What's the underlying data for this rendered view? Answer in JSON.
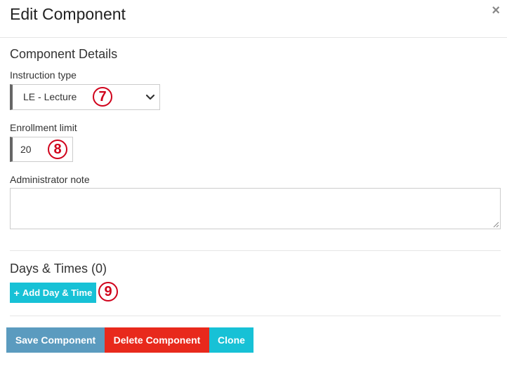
{
  "modal": {
    "title": "Edit Component",
    "close_label": "×"
  },
  "details": {
    "section_title": "Component Details",
    "instruction_type": {
      "label": "Instruction type",
      "value": "LE - Lecture"
    },
    "enrollment_limit": {
      "label": "Enrollment limit",
      "value": "20"
    },
    "administrator_note": {
      "label": "Administrator note",
      "value": ""
    }
  },
  "days_times": {
    "section_title": "Days & Times (0)",
    "add_label": "Add Day & Time"
  },
  "annotations": {
    "callout_7": "7",
    "callout_8": "8",
    "callout_9": "9"
  },
  "footer": {
    "save_label": "Save Component",
    "delete_label": "Delete Component",
    "clone_label": "Clone"
  },
  "colors": {
    "save": "#5b9bbf",
    "delete": "#e8291c",
    "accent": "#17c1d6",
    "callout": "#d0021b"
  },
  "icons": {
    "close": "close-icon",
    "select": "chevron-down-icon",
    "add": "plus-icon",
    "resize": "resize-grip-icon"
  }
}
